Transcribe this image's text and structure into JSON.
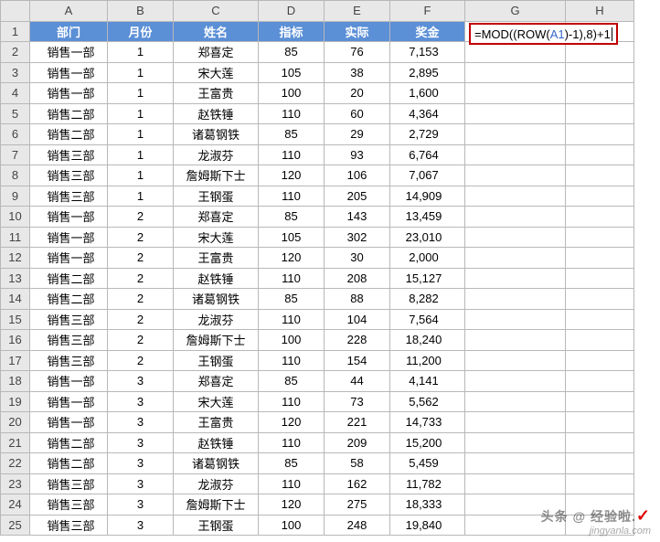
{
  "columns": [
    "A",
    "B",
    "C",
    "D",
    "E",
    "F",
    "G",
    "H"
  ],
  "headers": {
    "A": "部门",
    "B": "月份",
    "C": "姓名",
    "D": "指标",
    "E": "实际",
    "F": "奖金"
  },
  "formula": {
    "prefix": "=MOD((ROW(",
    "ref": "A1",
    "suffix": ")-1),8)+1"
  },
  "rows": [
    {
      "A": "销售一部",
      "B": "1",
      "C": "郑喜定",
      "D": "85",
      "E": "76",
      "F": "7,153"
    },
    {
      "A": "销售一部",
      "B": "1",
      "C": "宋大莲",
      "D": "105",
      "E": "38",
      "F": "2,895"
    },
    {
      "A": "销售一部",
      "B": "1",
      "C": "王富贵",
      "D": "100",
      "E": "20",
      "F": "1,600"
    },
    {
      "A": "销售二部",
      "B": "1",
      "C": "赵铁锤",
      "D": "110",
      "E": "60",
      "F": "4,364"
    },
    {
      "A": "销售二部",
      "B": "1",
      "C": "诸葛钢铁",
      "D": "85",
      "E": "29",
      "F": "2,729"
    },
    {
      "A": "销售三部",
      "B": "1",
      "C": "龙淑芬",
      "D": "110",
      "E": "93",
      "F": "6,764"
    },
    {
      "A": "销售三部",
      "B": "1",
      "C": "詹姆斯下士",
      "D": "120",
      "E": "106",
      "F": "7,067"
    },
    {
      "A": "销售三部",
      "B": "1",
      "C": "王钢蛋",
      "D": "110",
      "E": "205",
      "F": "14,909"
    },
    {
      "A": "销售一部",
      "B": "2",
      "C": "郑喜定",
      "D": "85",
      "E": "143",
      "F": "13,459"
    },
    {
      "A": "销售一部",
      "B": "2",
      "C": "宋大莲",
      "D": "105",
      "E": "302",
      "F": "23,010"
    },
    {
      "A": "销售一部",
      "B": "2",
      "C": "王富贵",
      "D": "120",
      "E": "30",
      "F": "2,000"
    },
    {
      "A": "销售二部",
      "B": "2",
      "C": "赵铁锤",
      "D": "110",
      "E": "208",
      "F": "15,127"
    },
    {
      "A": "销售二部",
      "B": "2",
      "C": "诸葛钢铁",
      "D": "85",
      "E": "88",
      "F": "8,282"
    },
    {
      "A": "销售三部",
      "B": "2",
      "C": "龙淑芬",
      "D": "110",
      "E": "104",
      "F": "7,564"
    },
    {
      "A": "销售三部",
      "B": "2",
      "C": "詹姆斯下士",
      "D": "100",
      "E": "228",
      "F": "18,240"
    },
    {
      "A": "销售三部",
      "B": "2",
      "C": "王钢蛋",
      "D": "110",
      "E": "154",
      "F": "11,200"
    },
    {
      "A": "销售一部",
      "B": "3",
      "C": "郑喜定",
      "D": "85",
      "E": "44",
      "F": "4,141"
    },
    {
      "A": "销售一部",
      "B": "3",
      "C": "宋大莲",
      "D": "110",
      "E": "73",
      "F": "5,562"
    },
    {
      "A": "销售一部",
      "B": "3",
      "C": "王富贵",
      "D": "120",
      "E": "221",
      "F": "14,733"
    },
    {
      "A": "销售二部",
      "B": "3",
      "C": "赵铁锤",
      "D": "110",
      "E": "209",
      "F": "15,200"
    },
    {
      "A": "销售二部",
      "B": "3",
      "C": "诸葛钢铁",
      "D": "85",
      "E": "58",
      "F": "5,459"
    },
    {
      "A": "销售三部",
      "B": "3",
      "C": "龙淑芬",
      "D": "110",
      "E": "162",
      "F": "11,782"
    },
    {
      "A": "销售三部",
      "B": "3",
      "C": "詹姆斯下士",
      "D": "120",
      "E": "275",
      "F": "18,333"
    },
    {
      "A": "销售三部",
      "B": "3",
      "C": "王钢蛋",
      "D": "100",
      "E": "248",
      "F": "19,840"
    }
  ],
  "watermark": {
    "line1_a": "头条 @ ",
    "line1_b": "经验啦.",
    "line2": "jingyanla.com"
  }
}
